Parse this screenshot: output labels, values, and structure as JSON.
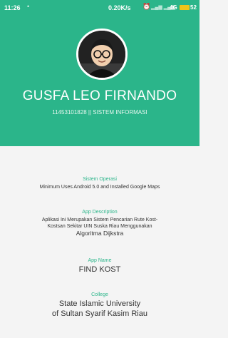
{
  "status_bar": {
    "time": "11:26",
    "speed": "0.20K/s",
    "network": "4G",
    "battery": "52"
  },
  "profile": {
    "name": "GUSFA LEO FIRNANDO",
    "subtitle": "11453101828 || SISTEM INFORMASI"
  },
  "sections": {
    "os": {
      "label": "Sistem Operasi",
      "value": "Minimum Uses Android 5.0 and Installed Google Maps"
    },
    "description": {
      "label": "App Description",
      "line1": "Aplikasi Ini Merupakan Sistem Pencarian Rute Kost-",
      "line2": "Kostsan Sekitar UIN Suska Riau Menggunakan",
      "line3": "Algoritma Dijkstra"
    },
    "app_name": {
      "label": "App Name",
      "value": "FIND KOST"
    },
    "college": {
      "label": "College",
      "line1": "State Islamic University",
      "line2": "of Sultan Syarif Kasim Riau"
    }
  },
  "colors": {
    "accent": "#2bb58a",
    "background": "#f4f4f4",
    "text": "#333333"
  }
}
